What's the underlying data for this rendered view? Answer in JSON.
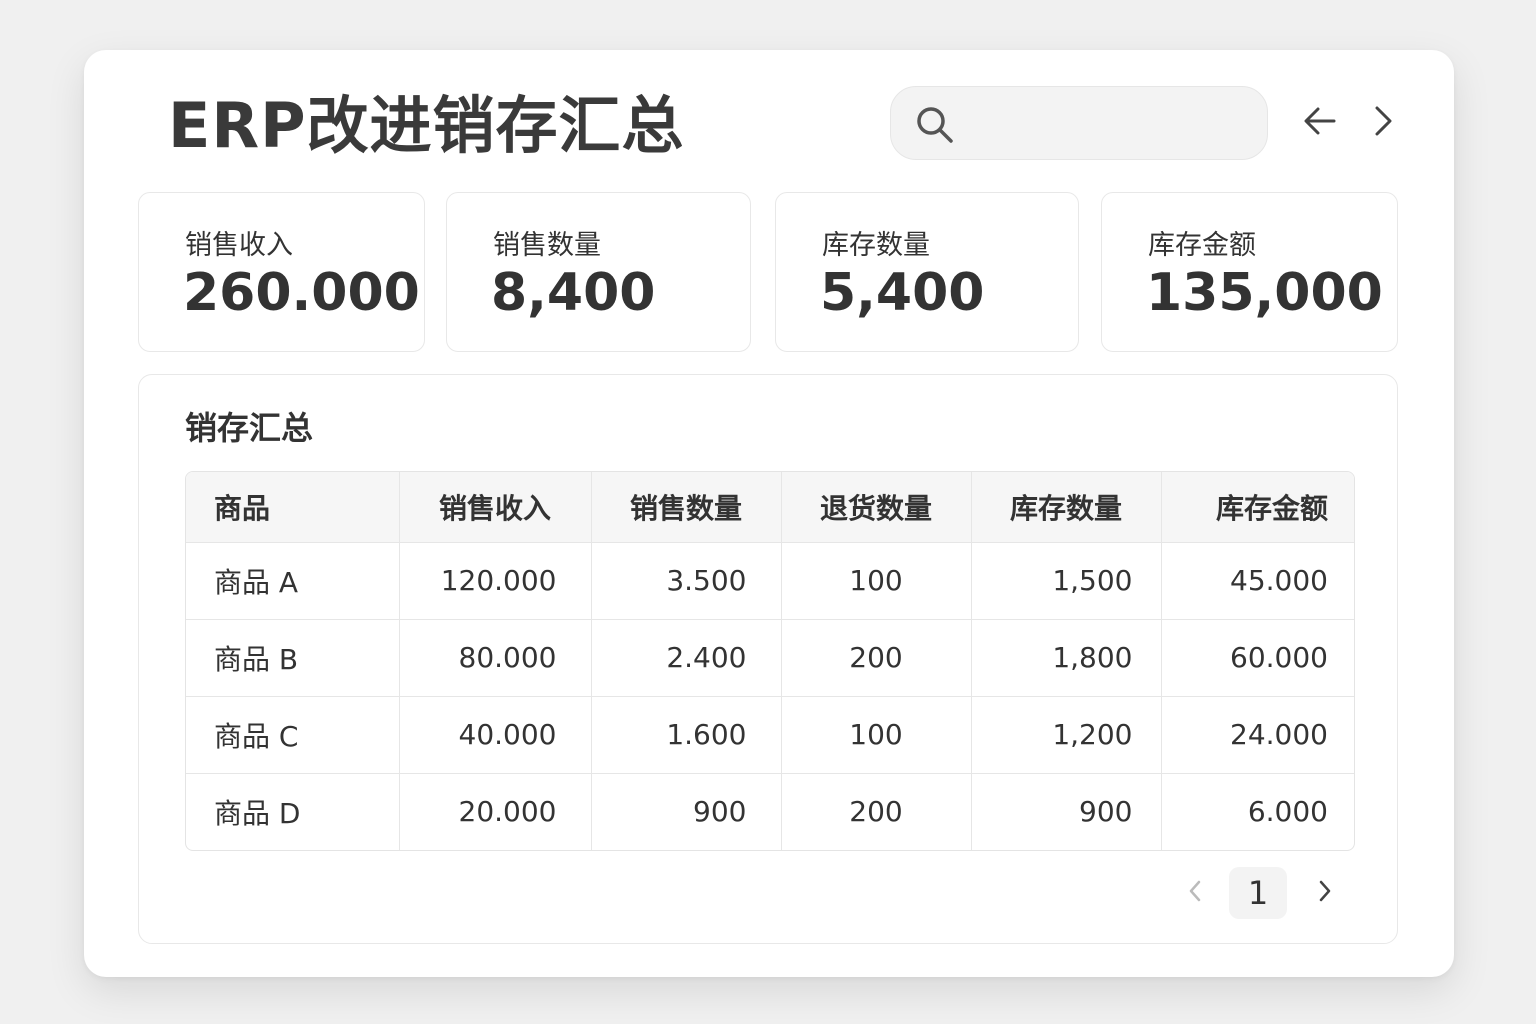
{
  "header": {
    "title": "ERP改进销存汇总",
    "search": {
      "value": "",
      "placeholder": ""
    },
    "nav": {
      "prev_icon": "arrow-left-icon",
      "next_icon": "chevron-right-icon"
    }
  },
  "stats": [
    {
      "label": "销售收入",
      "value": "260.000"
    },
    {
      "label": "销售数量",
      "value": "8,400"
    },
    {
      "label": "库存数量",
      "value": "5,400"
    },
    {
      "label": "库存金额",
      "value": "135,000"
    }
  ],
  "summary": {
    "title": "销存汇总",
    "columns": [
      "商品",
      "销售收入",
      "销售数量",
      "退货数量",
      "库存数量",
      "库存金额"
    ],
    "rows": [
      [
        "商品 A",
        "120.000",
        "3.500",
        "100",
        "1,500",
        "45.000"
      ],
      [
        "商品 B",
        "80.000",
        "2.400",
        "200",
        "1,800",
        "60.000"
      ],
      [
        "商品 C",
        "40.000",
        "1.600",
        "100",
        "1,200",
        "24.000"
      ],
      [
        "商品 D",
        "20.000",
        "900",
        "200",
        "900",
        "6.000"
      ]
    ]
  },
  "pagination": {
    "current": "1"
  },
  "colors": {
    "background": "#f0f0f0",
    "card": "#ffffff",
    "text": "#333333",
    "header_row": "#f6f6f6"
  }
}
